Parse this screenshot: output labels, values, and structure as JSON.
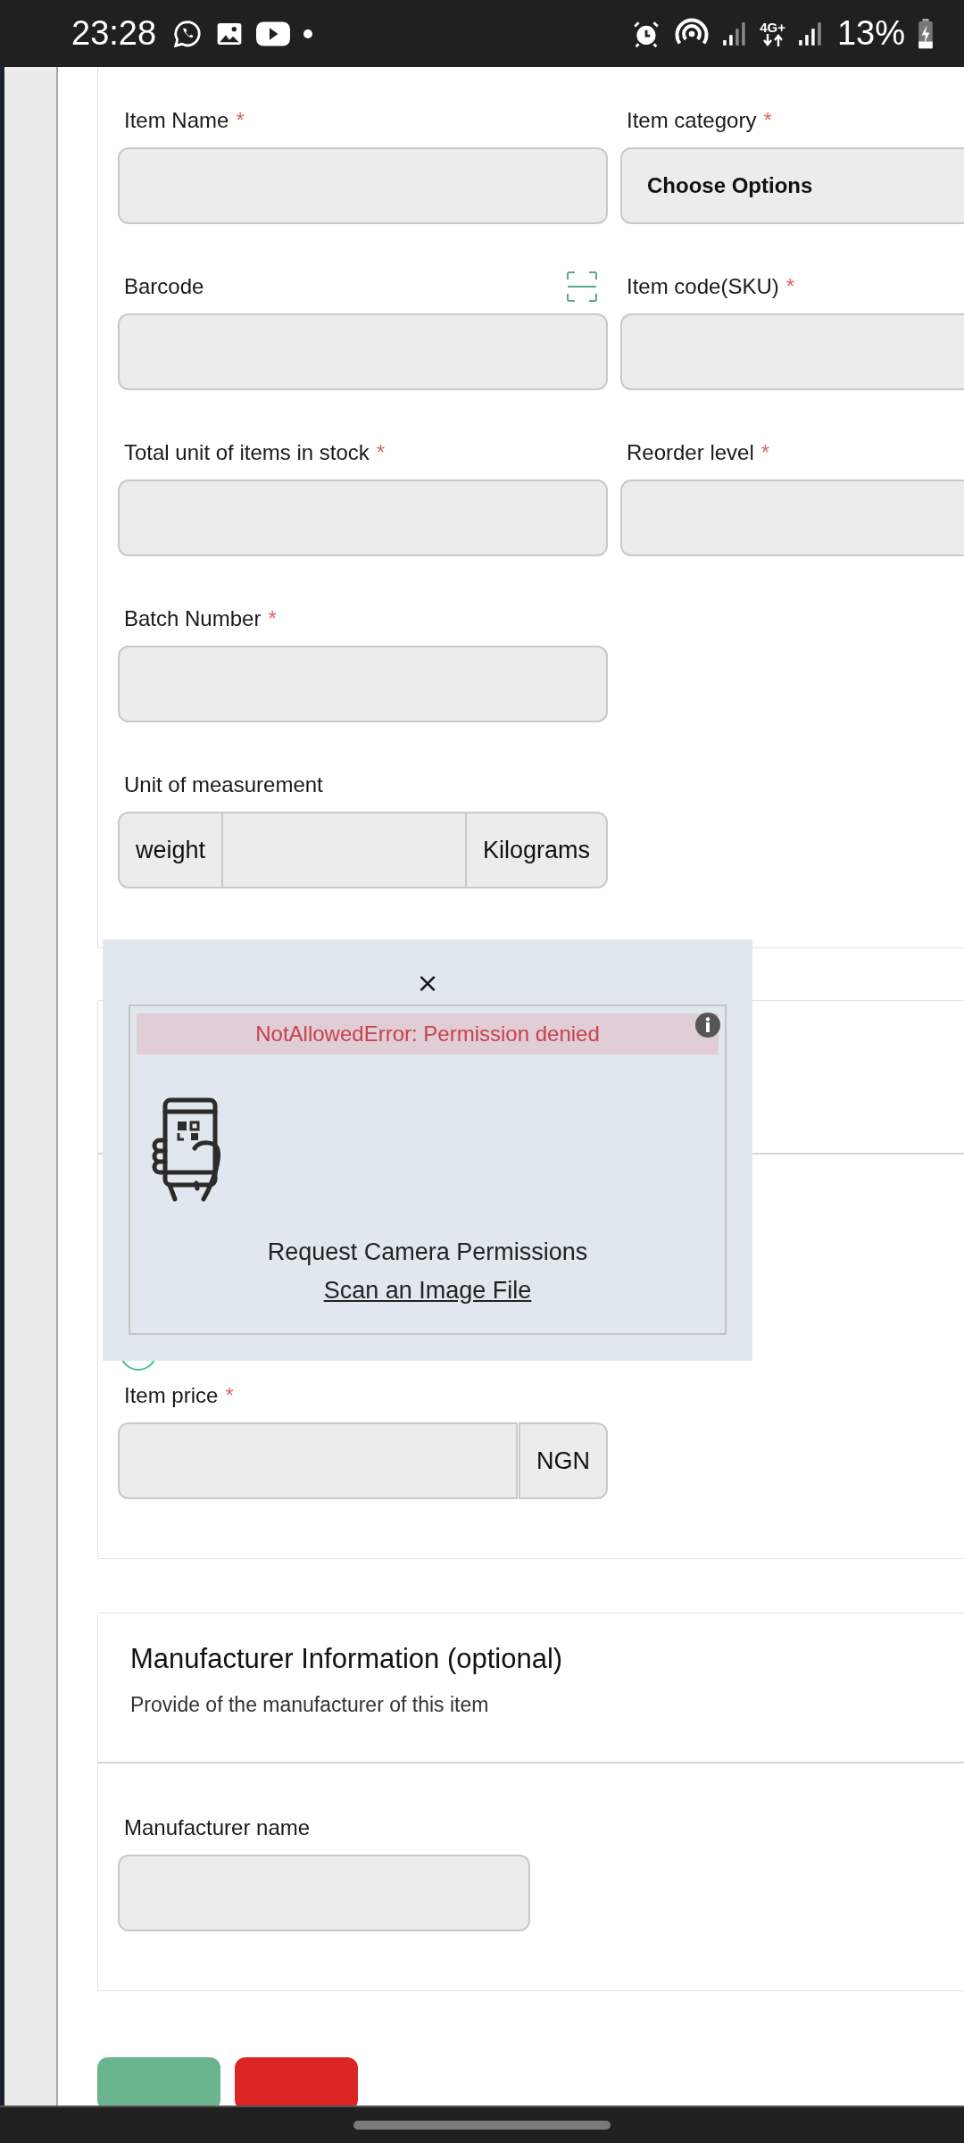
{
  "status_bar": {
    "time": "23:28",
    "network": "4G+",
    "battery": "13%"
  },
  "item_section": {
    "rows": [
      [
        {
          "kind": "text",
          "label": "Item Name",
          "required_mark": "*"
        },
        {
          "kind": "select",
          "label": "Item category",
          "required_mark": "*",
          "value": "Choose Options"
        }
      ],
      [
        {
          "kind": "barcode",
          "label": "Barcode"
        },
        {
          "kind": "text",
          "label": "Item code(SKU)",
          "required_mark": "*"
        }
      ],
      [
        {
          "kind": "text",
          "label": "Total unit of items in stock",
          "required_mark": "*"
        },
        {
          "kind": "text",
          "label": "Reorder level",
          "required_mark": "*"
        }
      ],
      [
        {
          "kind": "text",
          "label": "Batch Number",
          "required_mark": "*"
        }
      ],
      [
        {
          "kind": "unit",
          "label": "Unit of measurement",
          "prefix": "weight",
          "suffix": "Kilograms"
        }
      ]
    ]
  },
  "price_section": {
    "label": "Item price",
    "required_mark": "*",
    "currency": "NGN"
  },
  "manufacturer_section": {
    "title": "Manufacturer Information (optional)",
    "description": "Provide of the manufacturer of this item",
    "fields": [
      {
        "label": "Manufacturer name"
      }
    ]
  },
  "buttons": [
    {
      "kind": "submit"
    },
    {
      "kind": "cancel"
    }
  ],
  "scanner_dialog": {
    "close": "×",
    "error": "NotAllowedError: Permission denied",
    "request": "Request Camera Permissions",
    "scan_file": "Scan an Image File"
  }
}
